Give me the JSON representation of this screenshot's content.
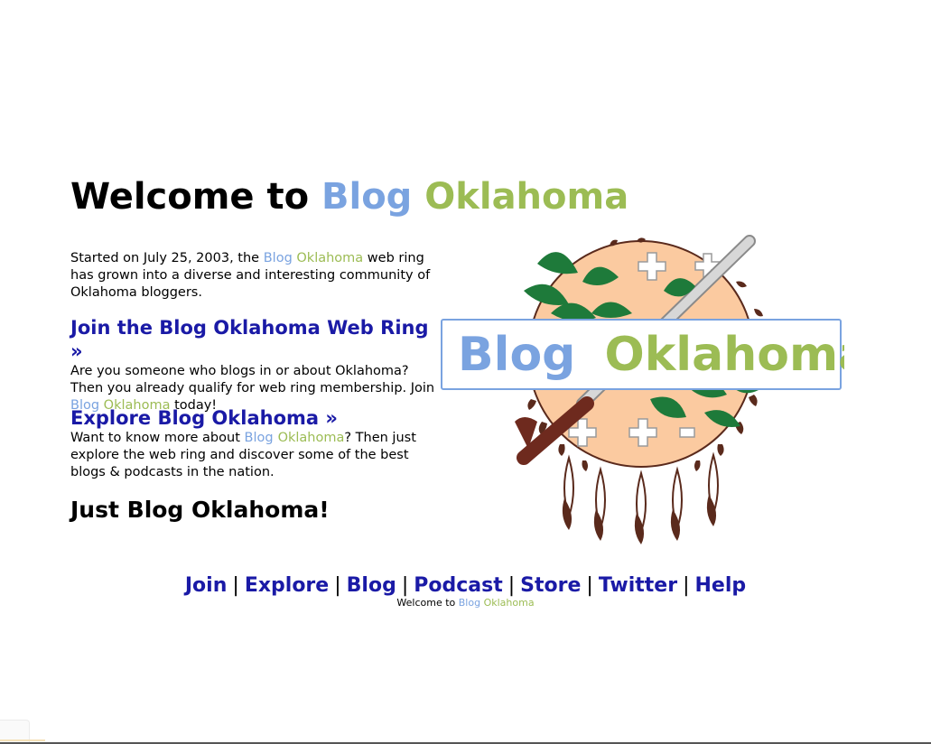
{
  "hero": {
    "prefix": "Welcome to",
    "brand_blue": "Blog",
    "brand_green": "Oklahoma"
  },
  "intro": {
    "before": "Started on July 25, 2003, the",
    "brand_blue": "Blog",
    "brand_green": "Oklahoma",
    "after": "web ring has grown into a diverse and interesting community of Oklahoma bloggers."
  },
  "join_section": {
    "heading": "Join the Blog Oklahoma Web Ring »",
    "text_before": "Are you someone who blogs in or about Oklahoma? Then you already qualify for web ring membership. Join",
    "brand_blue": "Blog",
    "brand_green": "Oklahoma",
    "text_after": "today!"
  },
  "explore_section": {
    "heading": "Explore Blog Oklahoma »",
    "text_before": "Want to know more about",
    "brand_blue": "Blog",
    "brand_green": "Oklahoma",
    "text_after": "? Then just explore the web ring and discover some of the best blogs & podcasts in the nation."
  },
  "tagline": "Just Blog Oklahoma!",
  "logo": {
    "blue": "Blog",
    "green": "Oklahoma"
  },
  "nav": {
    "join": "Join",
    "explore": "Explore",
    "blog": "Blog",
    "podcast": "Podcast",
    "store": "Store",
    "twitter": "Twitter",
    "help": "Help",
    "separator": "|"
  },
  "footer": {
    "prefix": "Welcome to",
    "brand_blue": "Blog",
    "brand_green": "Oklahoma"
  },
  "colors": {
    "brand_blue": "#7aa3e0",
    "brand_green": "#9cbc54",
    "link": "#1a1aa6",
    "seal_shield": "#fbcaa0",
    "olive_branch": "#1e7a3a",
    "feather_brown": "#5a2a1c"
  }
}
